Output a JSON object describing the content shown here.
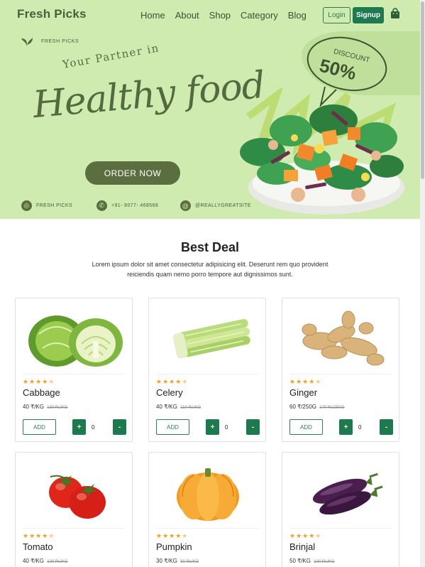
{
  "nav": {
    "brand": "Fresh Picks",
    "links": [
      "Home",
      "About",
      "Shop",
      "Category",
      "Blog"
    ],
    "login": "Login",
    "signup": "Signup"
  },
  "hero": {
    "logo_text": "FRESH PICKS",
    "tagline": "Your Partner in",
    "headline": "Healthy food",
    "discount_label": "DISCOUNT",
    "discount_value": "50%",
    "cta": "ORDER NOW",
    "contacts": {
      "brand": "FRESH PICKS",
      "phone": "+91- 8077- 468568",
      "handle": "@REALLYGREATSITE"
    }
  },
  "deals": {
    "title": "Best Deal",
    "subtitle": "Lorem ipsum dolor sit amet consectetur adipisicing elit. Deserunt rem quo provident reiciendis quam nemo porro tempore aut dignissimos sunt.",
    "products": [
      {
        "name": "Cabbage",
        "price": "40 ₹/KG",
        "old_price": "130 Rs/KG",
        "qty": "0",
        "add": "ADD",
        "rating": "4.5"
      },
      {
        "name": "Celery",
        "price": "40 ₹/KG",
        "old_price": "110 Rs/KG",
        "qty": "0",
        "add": "ADD",
        "rating": "4.5"
      },
      {
        "name": "Ginger",
        "price": "60 ₹/250G",
        "old_price": "170 Rs/250G",
        "qty": "0",
        "add": "ADD",
        "rating": "4.5"
      },
      {
        "name": "Tomato",
        "price": "40 ₹/KG",
        "old_price": "100 Rs/KG",
        "rating": "4.5"
      },
      {
        "name": "Pumpkin",
        "price": "30 ₹/KG",
        "old_price": "90 Rs/KG",
        "rating": "4.5"
      },
      {
        "name": "Brinjal",
        "price": "50 ₹/KG",
        "old_price": "100 Rs/KG",
        "rating": "4.5"
      }
    ],
    "stars_glyph": "★★★★",
    "half_star": "★",
    "plus": "+",
    "minus": "-"
  },
  "colors": {
    "hero_bg": "#d0ebb0",
    "primary_green": "#1d7a4f",
    "olive": "#5b6e3f",
    "star": "#f0a020"
  }
}
